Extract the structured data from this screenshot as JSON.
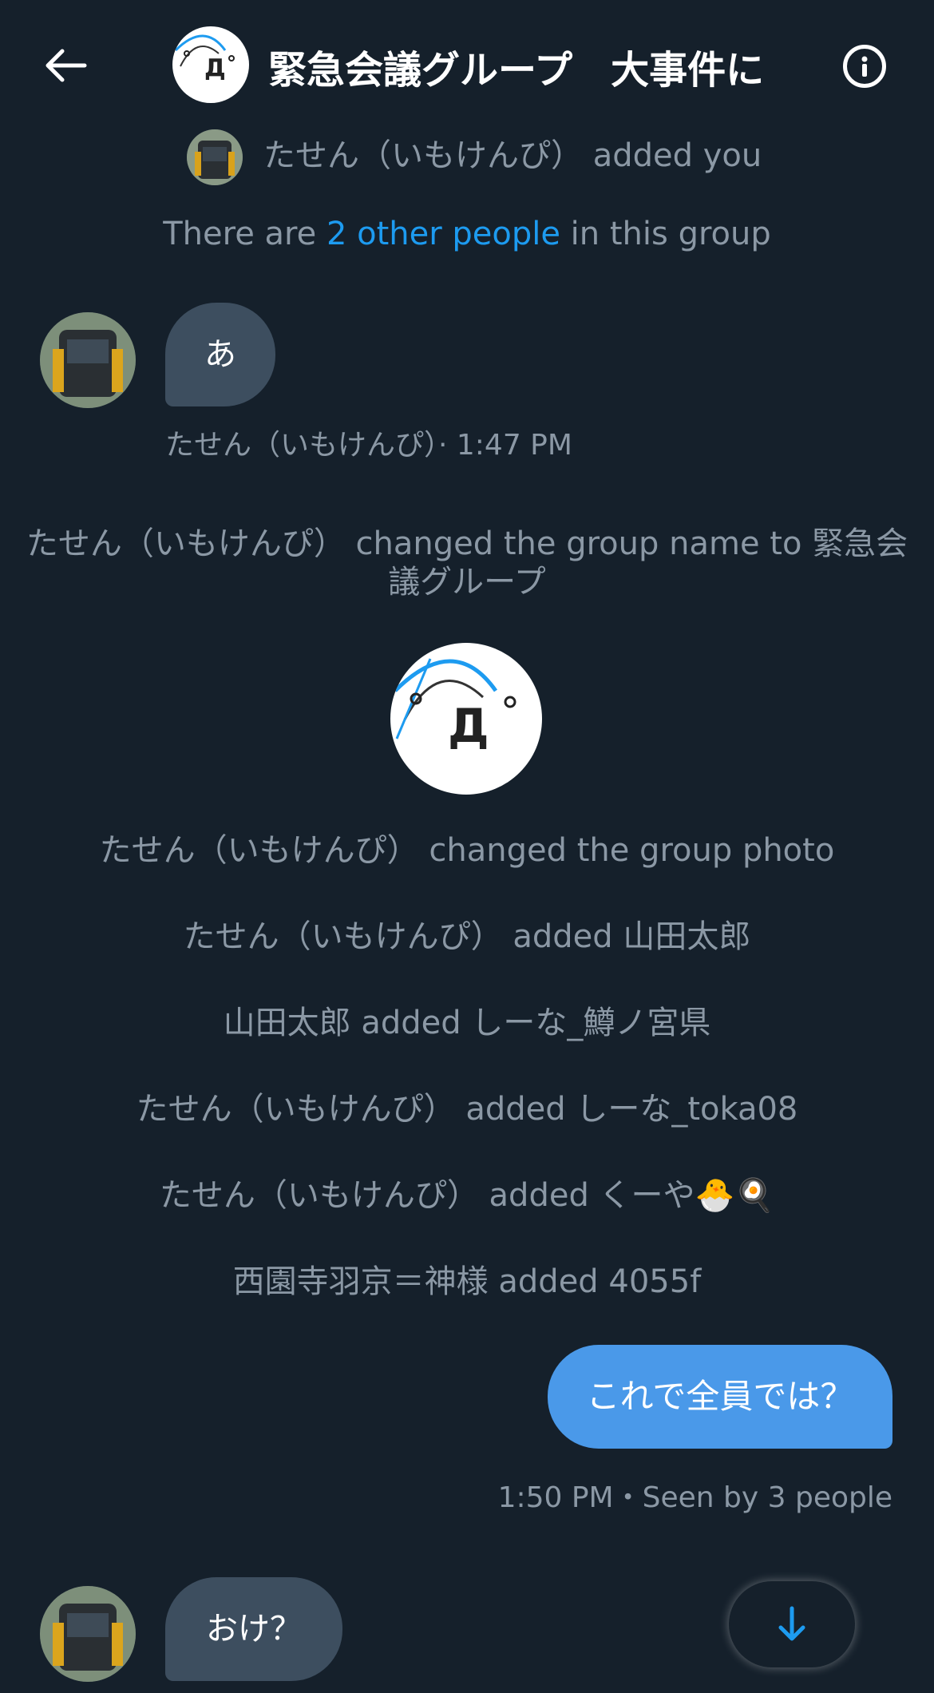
{
  "header": {
    "title": "緊急会議グループ　大事件に"
  },
  "system": {
    "added_you_name": "たせん（いもけんぴ）",
    "added_you_text": "added you",
    "others_prefix": "There are ",
    "others_link": "2 other people",
    "others_suffix": " in this group",
    "rename_line1": "たせん（いもけんぴ） changed the group name to 緊急会",
    "rename_line2": "議グループ",
    "photo_changed": "たせん（いもけんぴ） changed the group photo",
    "events": [
      "たせん（いもけんぴ） added 山田太郎",
      "山田太郎 added しーな_鱒ノ宮県",
      "たせん（いもけんぴ） added しーな_toka08",
      "たせん（いもけんぴ） added くーや🐣🍳",
      "西園寺羽京＝神様 added 4055f"
    ]
  },
  "messages": {
    "first": {
      "text": "あ",
      "meta": "たせん（いもけんぴ）· 1:47 PM"
    },
    "mine": {
      "text": "これで全員では？",
      "meta": "1:50 PM・Seen by 3 people"
    },
    "last": {
      "text": "おけ？"
    }
  },
  "colors": {
    "background": "#15202b",
    "accent": "#1d9bf0",
    "outgoing_bubble": "#4a99e9",
    "incoming_bubble": "#3d4e5f",
    "muted_text": "#8b98a5"
  },
  "icons": [
    "back-arrow-icon",
    "info-icon",
    "arrow-down-icon"
  ]
}
